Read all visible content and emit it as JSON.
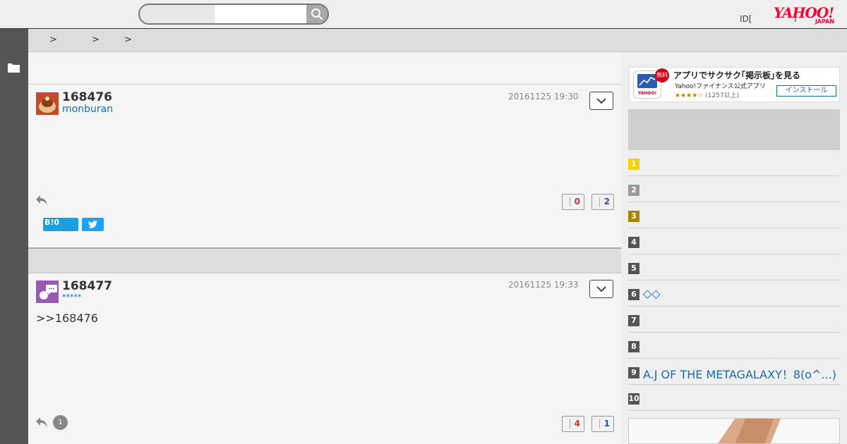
{
  "header": {
    "search": {
      "value": "",
      "placeholder": ""
    },
    "id_text": "ID[",
    "notice_mark": "]",
    "logo": {
      "main": "YAHOO!",
      "sub": "JAPAN"
    }
  },
  "breadcrumb": {
    "separators": [
      ">",
      ">",
      ">"
    ]
  },
  "posts": [
    {
      "number": "168476",
      "user": "monburan",
      "date": "20161125 19:30",
      "body": "",
      "good": "0",
      "bad": "2",
      "hatena_label": "B!0"
    },
    {
      "number": "168477",
      "user": "*****",
      "date": "20161125 19:33",
      "body": ">>168476",
      "reply_count": "1",
      "good": "4",
      "bad": "1"
    }
  ],
  "sidebar": {
    "app_banner": {
      "badge": "無料",
      "title": "アプリでサクサク｢掲示板｣を見る",
      "subtitle": "Yahoo!ファイナンス公式アプリ",
      "stars": "★★★★☆",
      "reviews": "(1257以上)",
      "install_label": "インストール"
    },
    "ranking": [
      {
        "rank": "1",
        "text": ""
      },
      {
        "rank": "2",
        "text": ""
      },
      {
        "rank": "3",
        "text": ""
      },
      {
        "rank": "4",
        "text": ""
      },
      {
        "rank": "5",
        "text": ""
      },
      {
        "rank": "6",
        "text": "◇◇"
      },
      {
        "rank": "7",
        "text": ""
      },
      {
        "rank": "8",
        "text": ""
      },
      {
        "rank": "9",
        "text": "A.J OF THE METAGALAXY！8(o^...)"
      },
      {
        "rank": "10",
        "text": ""
      }
    ]
  },
  "colors": {
    "accent_link": "#1a6ab0",
    "yahoo_red": "#ff0033",
    "good_vote": "#c0392b",
    "bad_vote": "#2e4fb0"
  }
}
